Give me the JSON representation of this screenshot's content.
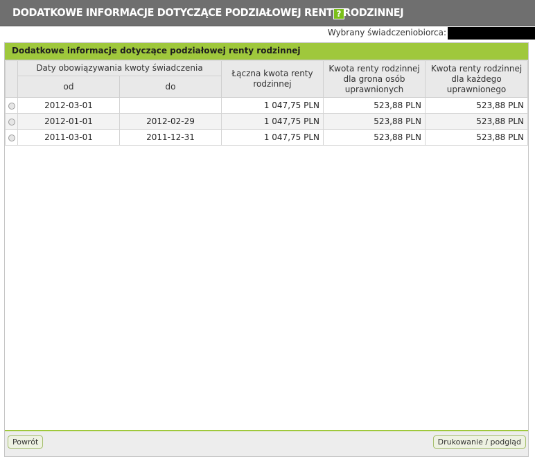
{
  "header": {
    "title": "DODATKOWE INFORMACJE DOTYCZĄCE PODZIAŁOWEJ RENTY RODZINNEJ",
    "help_label": "?"
  },
  "recipient": {
    "label": "Wybrany świadczeniobiorca:"
  },
  "panel": {
    "title": "Dodatkowe informacje dotyczące podziałowej renty rodzinnej"
  },
  "table": {
    "group_header": "Daty obowiązywania kwoty świadczenia",
    "col_from": "od",
    "col_to": "do",
    "col_total": "Łączna kwota renty rodzinnej",
    "col_group": "Kwota renty rodzinnej dla grona osób uprawnionych",
    "col_each": "Kwota renty rodzinnej dla każdego uprawnionego",
    "rows": [
      {
        "from": "2012-03-01",
        "to": "",
        "total": "1 047,75 PLN",
        "group": "523,88 PLN",
        "each": "523,88 PLN"
      },
      {
        "from": "2012-01-01",
        "to": "2012-02-29",
        "total": "1 047,75 PLN",
        "group": "523,88 PLN",
        "each": "523,88 PLN"
      },
      {
        "from": "2011-03-01",
        "to": "2011-12-31",
        "total": "1 047,75 PLN",
        "group": "523,88 PLN",
        "each": "523,88 PLN"
      }
    ]
  },
  "footer": {
    "back_label": "Powrót",
    "print_label": "Drukowanie / podgląd"
  },
  "colors": {
    "accent": "#9fc83c",
    "titlebar": "#6f6f6f"
  }
}
